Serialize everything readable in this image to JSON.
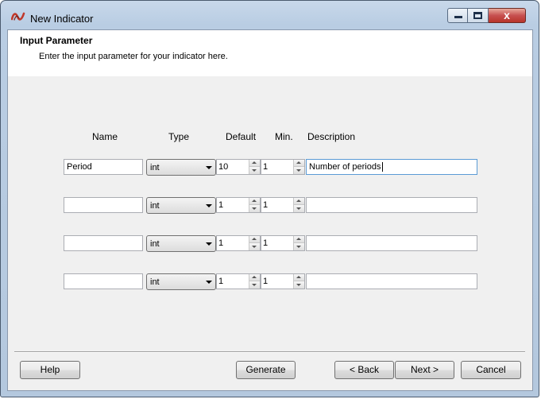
{
  "window": {
    "title": "New Indicator",
    "close_label": "x"
  },
  "header": {
    "title": "Input Parameter",
    "subtitle": "Enter the input parameter for your indicator here."
  },
  "columns": {
    "name": "Name",
    "type": "Type",
    "default": "Default",
    "min": "Min.",
    "description": "Description"
  },
  "rows": [
    {
      "name": "Period",
      "type": "int",
      "default": "10",
      "min": "1",
      "description": "Number of periods"
    },
    {
      "name": "",
      "type": "int",
      "default": "1",
      "min": "1",
      "description": ""
    },
    {
      "name": "",
      "type": "int",
      "default": "1",
      "min": "1",
      "description": ""
    },
    {
      "name": "",
      "type": "int",
      "default": "1",
      "min": "1",
      "description": ""
    }
  ],
  "buttons": {
    "help": "Help",
    "generate": "Generate",
    "back": "< Back",
    "next": "Next >",
    "cancel": "Cancel"
  }
}
